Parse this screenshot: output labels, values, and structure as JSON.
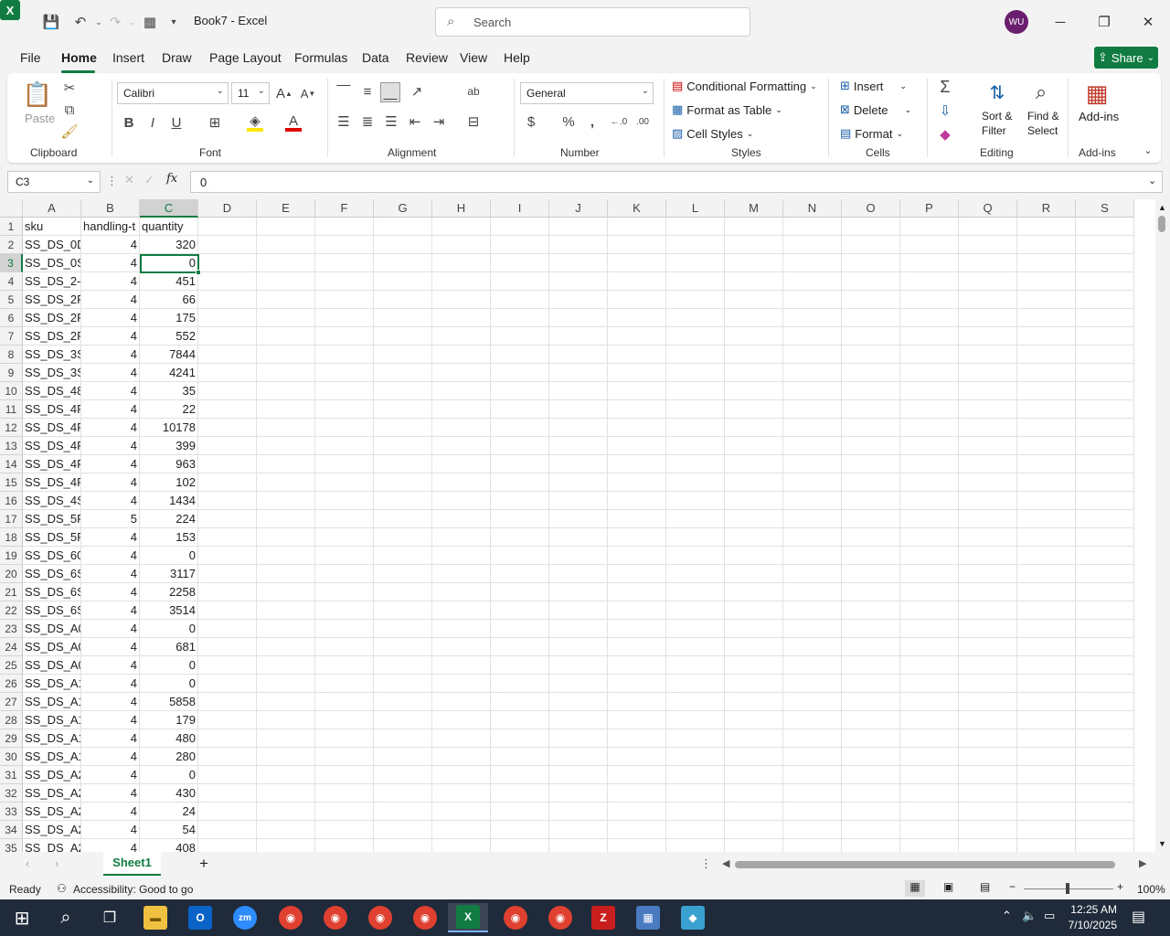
{
  "title_bar": {
    "doc_title": "Book7 - Excel",
    "search_placeholder": "Search",
    "avatar_initials": "WU"
  },
  "tabs": [
    "File",
    "Home",
    "Insert",
    "Draw",
    "Page Layout",
    "Formulas",
    "Data",
    "Review",
    "View",
    "Help"
  ],
  "share_label": "Share",
  "ribbon": {
    "clipboard": {
      "paste": "Paste",
      "group": "Clipboard"
    },
    "font": {
      "name": "Calibri",
      "size": "11",
      "group": "Font"
    },
    "alignment": {
      "group": "Alignment"
    },
    "number": {
      "format": "General",
      "group": "Number"
    },
    "styles": {
      "conditional": "Conditional Formatting",
      "format_table": "Format as Table",
      "cell_styles": "Cell Styles",
      "group": "Styles"
    },
    "cells": {
      "insert": "Insert",
      "delete": "Delete",
      "format": "Format",
      "group": "Cells"
    },
    "editing": {
      "sort_1": "Sort &",
      "sort_2": "Filter",
      "find_1": "Find &",
      "find_2": "Select",
      "group": "Editing"
    },
    "addins": {
      "label": "Add-ins",
      "group": "Add-ins"
    }
  },
  "formula_bar": {
    "name_box": "C3",
    "value": "0"
  },
  "columns": [
    "A",
    "B",
    "C",
    "D",
    "E",
    "F",
    "G",
    "H",
    "I",
    "J",
    "K",
    "L",
    "M",
    "N",
    "O",
    "P",
    "Q",
    "R",
    "S"
  ],
  "rows": [
    {
      "n": "1",
      "a": "sku",
      "b": "handling-t",
      "c": "quantity"
    },
    {
      "n": "2",
      "a": "SS_DS_0D",
      "b": "4",
      "c": "320"
    },
    {
      "n": "3",
      "a": "SS_DS_0S",
      "b": "4",
      "c": "0"
    },
    {
      "n": "4",
      "a": "SS_DS_2-S",
      "b": "4",
      "c": "451"
    },
    {
      "n": "5",
      "a": "SS_DS_2P",
      "b": "4",
      "c": "66"
    },
    {
      "n": "6",
      "a": "SS_DS_2P",
      "b": "4",
      "c": "175"
    },
    {
      "n": "7",
      "a": "SS_DS_2P",
      "b": "4",
      "c": "552"
    },
    {
      "n": "8",
      "a": "SS_DS_3S",
      "b": "4",
      "c": "7844"
    },
    {
      "n": "9",
      "a": "SS_DS_3S",
      "b": "4",
      "c": "4241"
    },
    {
      "n": "10",
      "a": "SS_DS_48",
      "b": "4",
      "c": "35"
    },
    {
      "n": "11",
      "a": "SS_DS_4P",
      "b": "4",
      "c": "22"
    },
    {
      "n": "12",
      "a": "SS_DS_4P",
      "b": "4",
      "c": "10178"
    },
    {
      "n": "13",
      "a": "SS_DS_4P",
      "b": "4",
      "c": "399"
    },
    {
      "n": "14",
      "a": "SS_DS_4P",
      "b": "4",
      "c": "963"
    },
    {
      "n": "15",
      "a": "SS_DS_4P",
      "b": "4",
      "c": "102"
    },
    {
      "n": "16",
      "a": "SS_DS_4S",
      "b": "4",
      "c": "1434"
    },
    {
      "n": "17",
      "a": "SS_DS_5P",
      "b": "5",
      "c": "224"
    },
    {
      "n": "18",
      "a": "SS_DS_5P",
      "b": "4",
      "c": "153"
    },
    {
      "n": "19",
      "a": "SS_DS_60",
      "b": "4",
      "c": "0"
    },
    {
      "n": "20",
      "a": "SS_DS_6S",
      "b": "4",
      "c": "3117"
    },
    {
      "n": "21",
      "a": "SS_DS_6S",
      "b": "4",
      "c": "2258"
    },
    {
      "n": "22",
      "a": "SS_DS_6S",
      "b": "4",
      "c": "3514"
    },
    {
      "n": "23",
      "a": "SS_DS_A0",
      "b": "4",
      "c": "0"
    },
    {
      "n": "24",
      "a": "SS_DS_A0",
      "b": "4",
      "c": "681"
    },
    {
      "n": "25",
      "a": "SS_DS_A0",
      "b": "4",
      "c": "0"
    },
    {
      "n": "26",
      "a": "SS_DS_A1",
      "b": "4",
      "c": "0"
    },
    {
      "n": "27",
      "a": "SS_DS_A1",
      "b": "4",
      "c": "5858"
    },
    {
      "n": "28",
      "a": "SS_DS_A1",
      "b": "4",
      "c": "179"
    },
    {
      "n": "29",
      "a": "SS_DS_A1",
      "b": "4",
      "c": "480"
    },
    {
      "n": "30",
      "a": "SS_DS_A1",
      "b": "4",
      "c": "280"
    },
    {
      "n": "31",
      "a": "SS_DS_A2",
      "b": "4",
      "c": "0"
    },
    {
      "n": "32",
      "a": "SS_DS_A2",
      "b": "4",
      "c": "430"
    },
    {
      "n": "33",
      "a": "SS_DS_A2",
      "b": "4",
      "c": "24"
    },
    {
      "n": "34",
      "a": "SS_DS_A2",
      "b": "4",
      "c": "54"
    },
    {
      "n": "35",
      "a": "SS_DS_A2",
      "b": "4",
      "c": "408"
    }
  ],
  "sheet": {
    "tab": "Sheet1",
    "add": "+"
  },
  "status": {
    "ready": "Ready",
    "accessibility": "Accessibility: Good to go",
    "zoom": "100%"
  },
  "clock": {
    "time": "12:25 AM",
    "date": "7/10/2025"
  },
  "colors": {
    "accent": "#107c41",
    "taskbar": "#1f2a3a"
  }
}
